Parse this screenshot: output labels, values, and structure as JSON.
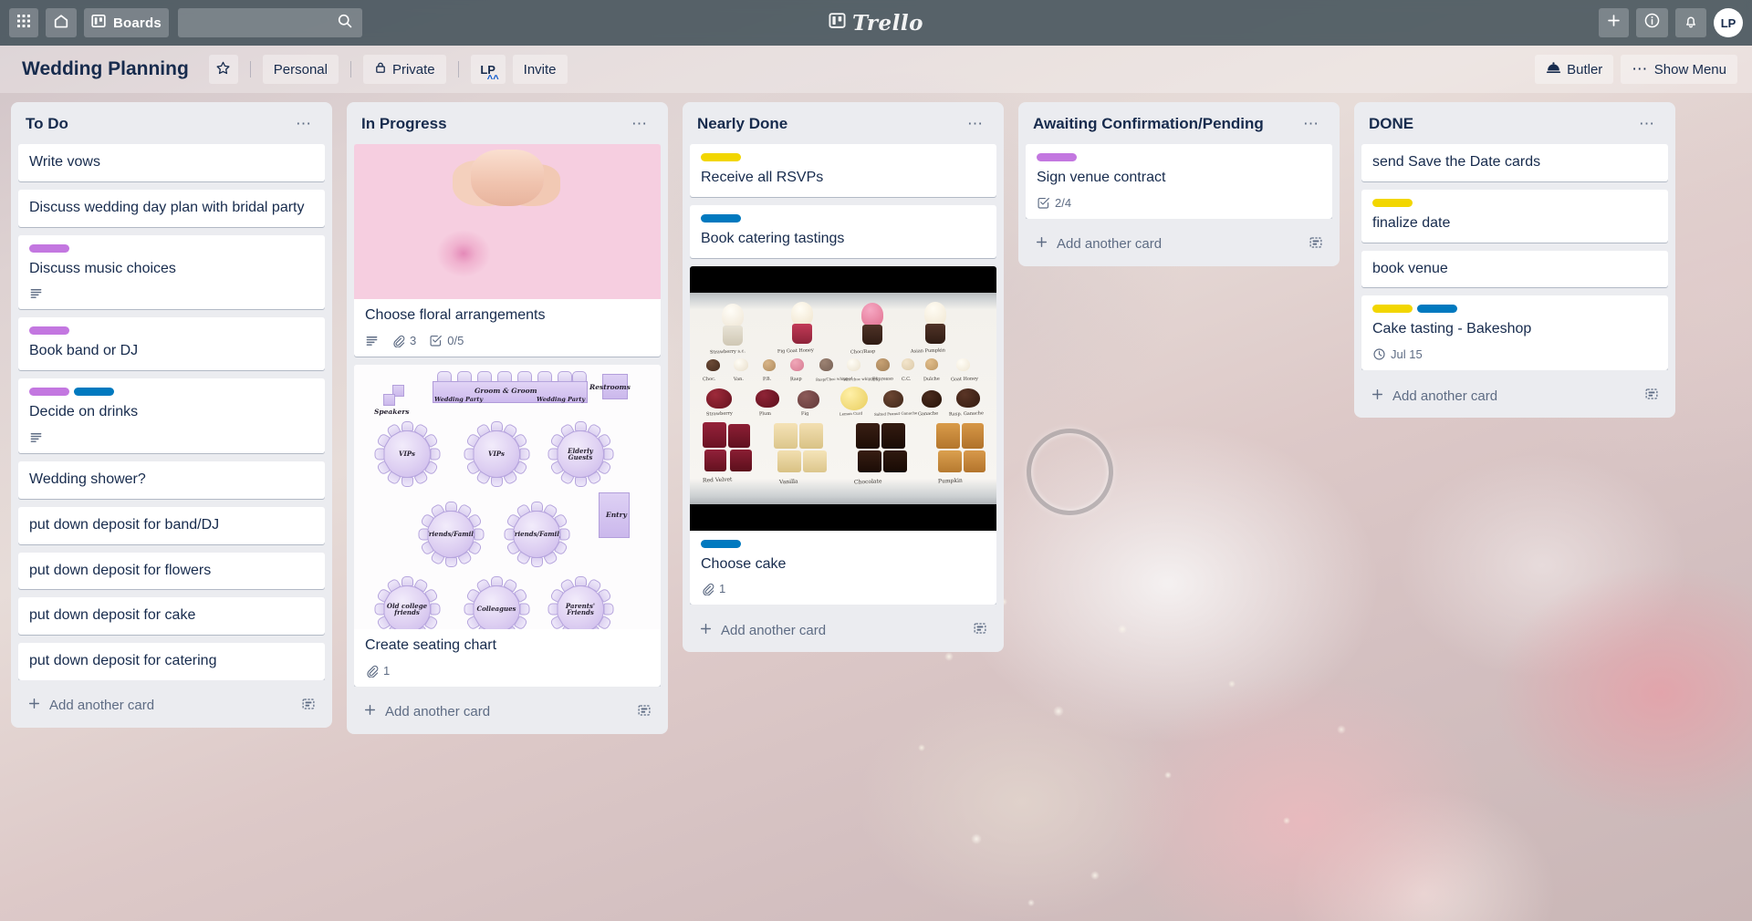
{
  "topnav": {
    "apps_icon": "grid-apps-icon",
    "home_icon": "home-icon",
    "boards_label": "Boards",
    "boards_icon": "board-icon",
    "search_placeholder": "",
    "search_value": "",
    "search_icon": "search-icon",
    "brand_name": "Trello",
    "brand_icon": "trello-logo-icon",
    "add_icon": "plus-icon",
    "info_icon": "info-icon",
    "notifications_icon": "bell-icon",
    "avatar_initials": "LP"
  },
  "boardheader": {
    "title": "Wedding Planning",
    "star_icon": "star-icon",
    "workspace_label": "Personal",
    "visibility_label": "Private",
    "visibility_icon": "lock-icon",
    "member_initials": "LP",
    "invite_label": "Invite",
    "butler_label": "Butler",
    "butler_icon": "butler-icon",
    "show_menu_label": "Show Menu",
    "show_menu_icon": "ellipsis-icon"
  },
  "colors": {
    "label_purple": "#c377e0",
    "label_blue": "#0079bf",
    "label_yellow": "#f2d600",
    "nav_bg": "#3e4d56",
    "list_bg": "#ebecf0",
    "text_dark": "#172b4d",
    "text_muted": "#5e6c84"
  },
  "add_card_label": "Add another card",
  "add_card_icon": "plus-icon",
  "template_icon": "template-card-icon",
  "lists": [
    {
      "title": "To Do",
      "menu_icon": "ellipsis-icon",
      "cards": [
        {
          "title": "Write vows",
          "labels": [],
          "badges": []
        },
        {
          "title": "Discuss wedding day plan with bridal party",
          "labels": [],
          "badges": []
        },
        {
          "title": "Discuss music choices",
          "labels": [
            "purple"
          ],
          "badges": [
            {
              "icon": "description-icon",
              "text": ""
            }
          ]
        },
        {
          "title": "Book band or DJ",
          "labels": [
            "purple"
          ],
          "badges": []
        },
        {
          "title": "Decide on drinks",
          "labels": [
            "purple",
            "blue"
          ],
          "badges": [
            {
              "icon": "description-icon",
              "text": ""
            }
          ]
        },
        {
          "title": "Wedding shower?",
          "labels": [],
          "badges": []
        },
        {
          "title": "put down deposit for band/DJ",
          "labels": [],
          "badges": []
        },
        {
          "title": "put down deposit for flowers",
          "labels": [],
          "badges": []
        },
        {
          "title": "put down deposit for cake",
          "labels": [],
          "badges": []
        },
        {
          "title": "put down deposit for catering",
          "labels": [],
          "badges": []
        }
      ]
    },
    {
      "title": "In Progress",
      "menu_icon": "ellipsis-icon",
      "cards": [
        {
          "title": "Choose floral arrangements",
          "labels": [],
          "cover": "bridal-bouquet-photo",
          "badges": [
            {
              "icon": "description-icon",
              "text": ""
            },
            {
              "icon": "attachment-icon",
              "text": "3"
            },
            {
              "icon": "checklist-icon",
              "text": "0/5"
            }
          ]
        },
        {
          "title": "Create seating chart",
          "labels": [],
          "cover": "seating-chart-diagram",
          "badges": [
            {
              "icon": "attachment-icon",
              "text": "1"
            }
          ]
        }
      ]
    },
    {
      "title": "Nearly Done",
      "menu_icon": "ellipsis-icon",
      "cards": [
        {
          "title": "Receive all RSVPs",
          "labels": [
            "yellow"
          ],
          "badges": []
        },
        {
          "title": "Book catering tastings",
          "labels": [
            "blue"
          ],
          "badges": []
        },
        {
          "title": "Choose cake",
          "labels": [
            "blue"
          ],
          "cover": "cake-tasting-tray-photo",
          "badges": [
            {
              "icon": "attachment-icon",
              "text": "1"
            }
          ]
        }
      ]
    },
    {
      "title": "Awaiting Confirmation/Pending",
      "menu_icon": "ellipsis-icon",
      "cards": [
        {
          "title": "Sign venue contract",
          "labels": [
            "purple"
          ],
          "badges": [
            {
              "icon": "checklist-icon",
              "text": "2/4"
            }
          ]
        }
      ]
    },
    {
      "title": "DONE",
      "menu_icon": "ellipsis-icon",
      "cards": [
        {
          "title": "send Save the Date cards",
          "labels": [],
          "badges": []
        },
        {
          "title": "finalize date",
          "labels": [
            "yellow"
          ],
          "badges": []
        },
        {
          "title": "book venue",
          "labels": [],
          "badges": []
        },
        {
          "title": "Cake tasting - Bakeshop",
          "labels": [
            "yellow",
            "blue"
          ],
          "badges": [
            {
              "icon": "clock-icon",
              "text": "Jul 15"
            }
          ]
        }
      ]
    }
  ],
  "seating_chart": {
    "head_table": "Groom & Groom",
    "wedding_party_left": "Wedding Party",
    "wedding_party_right": "Wedding Party",
    "speakers": "Speakers",
    "restrooms": "Restrooms",
    "entry": "Entry",
    "tables": [
      "VIPs",
      "VIPs",
      "Elderly Guests",
      "Friends/Family",
      "Friends/Family",
      "Old college friends",
      "Colleagues",
      "Parents' Friends"
    ]
  },
  "cake_tray": {
    "cupcake_labels": [
      "Strawberry s.c.",
      "Fig Goat Honey",
      "Choc/Rasp",
      "Asian Pumpkin"
    ],
    "dot_labels": [
      "Choc.",
      "Van.",
      "P.B.",
      "Rasp",
      "Rasp/Choc whipped",
      "Wht choc whipped",
      "Espresso",
      "C.C.",
      "Dulche",
      "Goat Honey"
    ],
    "filling_labels": [
      "Strawberry",
      "Plum",
      "Fig",
      "Lemon Curd",
      "Salted Peanut Ganache",
      "Ganache",
      "Rasp. Ganache"
    ],
    "cake_labels": [
      "Red Velvet",
      "Vanilla",
      "Chocolate",
      "Pumpkin"
    ]
  }
}
